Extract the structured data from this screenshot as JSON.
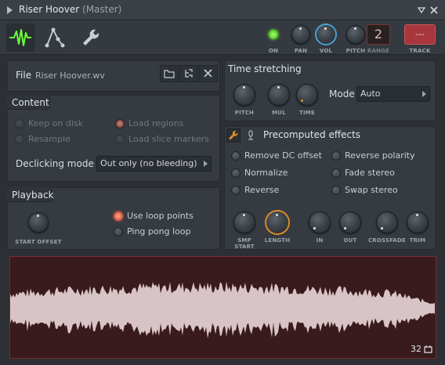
{
  "window": {
    "title": "Riser Hoover",
    "subtitle": "(Master)",
    "menu_icon": "triangle-right-icon",
    "close_icon": "close-icon"
  },
  "toolbar": {
    "tabs": [
      {
        "name": "sample-tab",
        "icon": "waveform-icon",
        "active": true
      },
      {
        "name": "envelope-tab",
        "icon": "envelope-icon",
        "active": false
      },
      {
        "name": "tools-tab",
        "icon": "wrench-icon",
        "active": false
      }
    ],
    "on_label": "ON",
    "pan_label": "PAN",
    "vol_label": "VOL",
    "pitch_label": "PITCH",
    "range_label": "RANGE",
    "range_value": "2",
    "track_label": "TRACK",
    "track_value": "---",
    "on_state": true,
    "accent_green": "#6cff3a",
    "accent_blue": "#4aa3d8"
  },
  "file": {
    "label": "File",
    "value": "Riser Hoover.wv",
    "open_icon": "folder-icon",
    "link_icon": "link-icon",
    "clear_icon": "close-icon"
  },
  "content": {
    "title": "Content",
    "keep_on_disk": "Keep on disk",
    "resample": "Resample",
    "load_regions": "Load regions",
    "load_slice_markers": "Load slice markers",
    "declicking_label": "Declicking mode",
    "declicking_value": "Out only (no bleeding)"
  },
  "playback": {
    "title": "Playback",
    "start_offset_label": "START OFFSET",
    "use_loop_points": "Use loop points",
    "ping_pong_loop": "Ping pong loop"
  },
  "time_stretching": {
    "title": "Time stretching",
    "pitch_label": "PITCH",
    "mul_label": "MUL",
    "time_label": "TIME",
    "mode_label": "Mode",
    "mode_value": "Auto"
  },
  "precomputed": {
    "title": "Precomputed effects",
    "remove_dc_offset": "Remove DC offset",
    "reverse_polarity": "Reverse polarity",
    "normalize": "Normalize",
    "fade_stereo": "Fade stereo",
    "reverse": "Reverse",
    "swap_stereo": "Swap stereo",
    "smp_start_label": "SMP START",
    "length_label": "LENGTH",
    "in_label": "IN",
    "out_label": "OUT",
    "crossfade_label": "CROSSFADE",
    "trim_label": "TRIM",
    "accent_orange": "#e08b2a"
  },
  "waveform": {
    "zoom_value": "32",
    "zoom_icon": "crop-icon",
    "background": "#3a1b1d",
    "wave_color": "#d8c4c6"
  }
}
